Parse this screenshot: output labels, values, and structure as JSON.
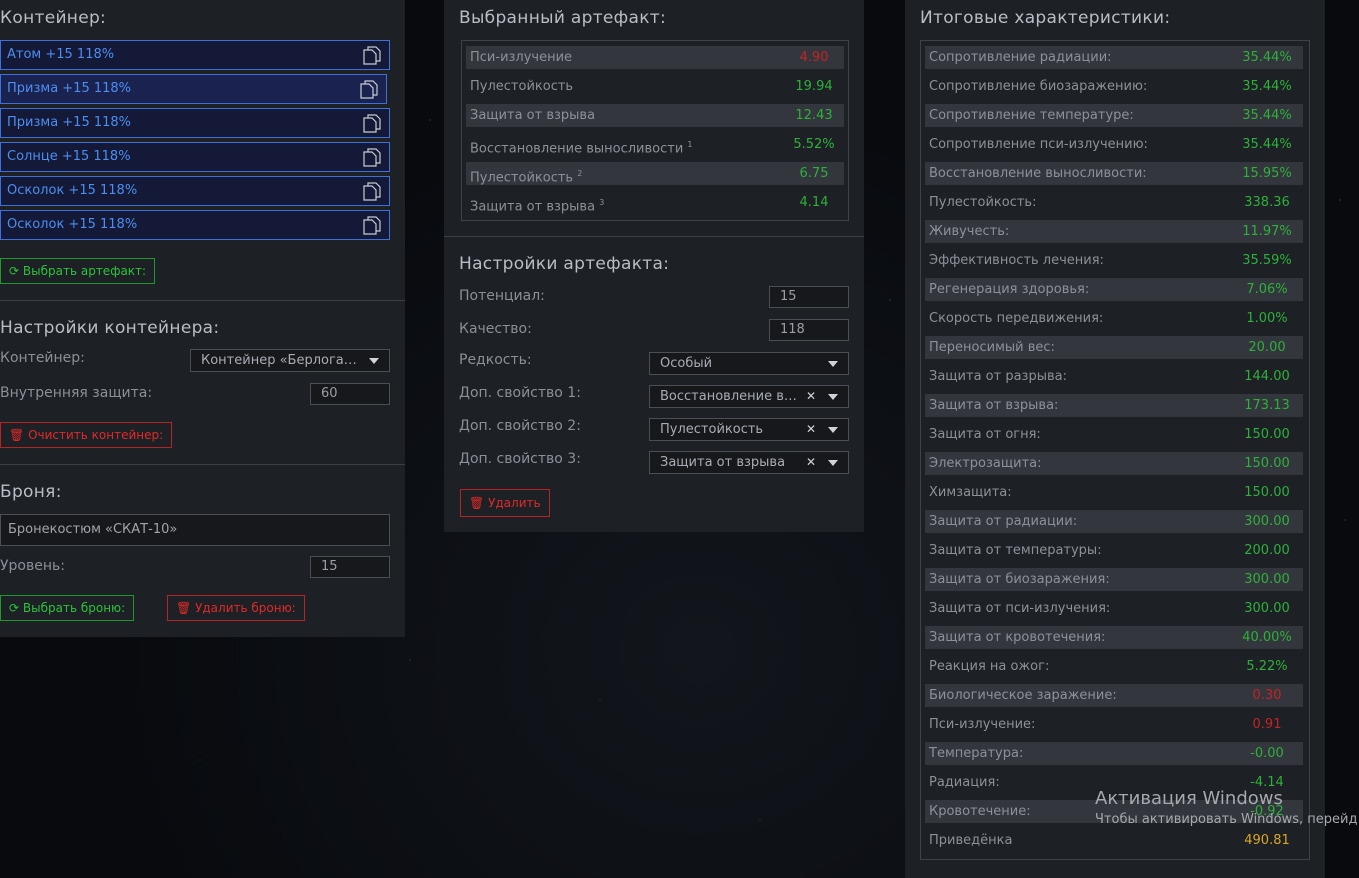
{
  "container_panel": {
    "title": "Контейнер:",
    "slots": [
      {
        "label": "Атом +15 118%"
      },
      {
        "label": "Призма +15 118%"
      },
      {
        "label": "Призма +15 118%"
      },
      {
        "label": "Солнце +15 118%"
      },
      {
        "label": "Осколок +15 118%"
      },
      {
        "label": "Осколок +15 118%"
      }
    ],
    "choose_artifact": "Выбрать артефакт:",
    "settings_title": "Настройки контейнера:",
    "container_label": "Контейнер:",
    "container_value": "Контейнер «Берлога…",
    "inner_protection_label": "Внутренняя защита:",
    "inner_protection_value": "60",
    "clear_button": "Очистить контейнер:",
    "armor_title": "Броня:",
    "armor_value": "Бронекостюм «СКАТ-10»",
    "level_label": "Уровень:",
    "level_value": "15",
    "choose_armor": "Выбрать броню:",
    "delete_armor": "Удалить броню:"
  },
  "artifact_panel": {
    "title": "Выбранный артефакт:",
    "stats": [
      {
        "name": "Пси-излучение",
        "sup": "",
        "value": "4.90",
        "color": "red"
      },
      {
        "name": "Пулестойкость",
        "sup": "",
        "value": "19.94",
        "color": "green"
      },
      {
        "name": "Защита от взрыва",
        "sup": "",
        "value": "12.43",
        "color": "green"
      },
      {
        "name": "Восстановление выносливости",
        "sup": "1",
        "value": "5.52%",
        "color": "green"
      },
      {
        "name": "Пулестойкость",
        "sup": "2",
        "value": "6.75",
        "color": "green"
      },
      {
        "name": "Защита от взрыва",
        "sup": "3",
        "value": "4.14",
        "color": "green"
      }
    ],
    "settings_title": "Настройки артефакта:",
    "potential_label": "Потенциал:",
    "potential_value": "15",
    "quality_label": "Качество:",
    "quality_value": "118",
    "rarity_label": "Редкость:",
    "rarity_value": "Особый",
    "extra1_label": "Доп. свойство 1:",
    "extra1_value": "Восстановление в…",
    "extra2_label": "Доп. свойство 2:",
    "extra2_value": "Пулестойкость",
    "extra3_label": "Доп. свойство 3:",
    "extra3_value": "Защита от взрыва",
    "delete_button": "Удалить"
  },
  "summary_panel": {
    "title": "Итоговые характеристики:",
    "stats": [
      {
        "name": "Сопротивление радиации:",
        "value": "35.44%",
        "color": "green"
      },
      {
        "name": "Сопротивление биозаражению:",
        "value": "35.44%",
        "color": "green"
      },
      {
        "name": "Сопротивление температуре:",
        "value": "35.44%",
        "color": "green"
      },
      {
        "name": "Сопротивление пси-излучению:",
        "value": "35.44%",
        "color": "green"
      },
      {
        "name": "Восстановление выносливости:",
        "value": "15.95%",
        "color": "green"
      },
      {
        "name": "Пулестойкость:",
        "value": "338.36",
        "color": "green"
      },
      {
        "name": "Живучесть:",
        "value": "11.97%",
        "color": "green"
      },
      {
        "name": "Эффективность лечения:",
        "value": "35.59%",
        "color": "green"
      },
      {
        "name": "Регенерация здоровья:",
        "value": "7.06%",
        "color": "green"
      },
      {
        "name": "Скорость передвижения:",
        "value": "1.00%",
        "color": "green"
      },
      {
        "name": "Переносимый вес:",
        "value": "20.00",
        "color": "green"
      },
      {
        "name": "Защита от разрыва:",
        "value": "144.00",
        "color": "green"
      },
      {
        "name": "Защита от взрыва:",
        "value": "173.13",
        "color": "green"
      },
      {
        "name": "Защита от огня:",
        "value": "150.00",
        "color": "green"
      },
      {
        "name": "Электрозащита:",
        "value": "150.00",
        "color": "green"
      },
      {
        "name": "Химзащита:",
        "value": "150.00",
        "color": "green"
      },
      {
        "name": "Защита от радиации:",
        "value": "300.00",
        "color": "green"
      },
      {
        "name": "Защита от температуры:",
        "value": "200.00",
        "color": "green"
      },
      {
        "name": "Защита от биозаражения:",
        "value": "300.00",
        "color": "green"
      },
      {
        "name": "Защита от пси-излучения:",
        "value": "300.00",
        "color": "green"
      },
      {
        "name": "Защита от кровотечения:",
        "value": "40.00%",
        "color": "green"
      },
      {
        "name": "Реакция на ожог:",
        "value": "5.22%",
        "color": "green"
      },
      {
        "name": "Биологическое заражение:",
        "value": "0.30",
        "color": "red"
      },
      {
        "name": "Пси-излучение:",
        "value": "0.91",
        "color": "red"
      },
      {
        "name": "Температура:",
        "value": "-0.00",
        "color": "green"
      },
      {
        "name": "Радиация:",
        "value": "-4.14",
        "color": "green"
      },
      {
        "name": "Кровотечение:",
        "value": "-0.92",
        "color": "green"
      },
      {
        "name": "Приведёнка",
        "value": "490.81",
        "color": "gold"
      }
    ]
  },
  "watermark": {
    "line1": "Активация Windows",
    "line2": "Чтобы активировать Windows, перейд"
  }
}
